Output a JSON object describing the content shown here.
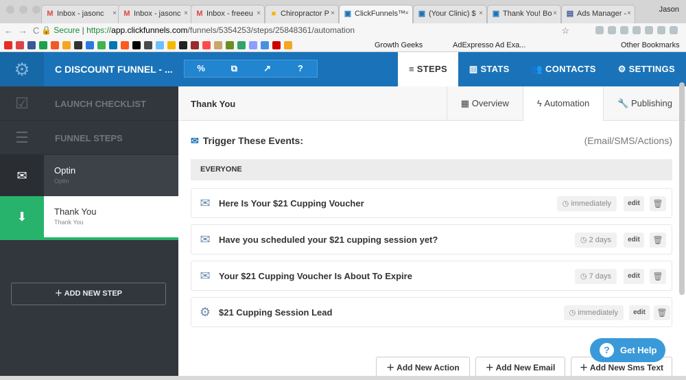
{
  "browser": {
    "tabs": [
      {
        "label": "Inbox - jasonc",
        "icon": "gmail-icon",
        "active": false
      },
      {
        "label": "Inbox - jasonc",
        "icon": "gmail-icon",
        "active": false
      },
      {
        "label": "Inbox - freeeu",
        "icon": "gmail-icon",
        "active": false
      },
      {
        "label": "Chiropractor P",
        "icon": "slides-icon",
        "active": false
      },
      {
        "label": "ClickFunnels™",
        "icon": "clickfunnels-icon",
        "active": true
      },
      {
        "label": "(Your Clinic) $",
        "icon": "clickfunnels-icon",
        "active": false
      },
      {
        "label": "Thank You! Bo",
        "icon": "clickfunnels-icon",
        "active": false
      },
      {
        "label": "Ads Manager -",
        "icon": "facebook-icon",
        "active": false
      }
    ],
    "profile": "Jason",
    "secure_label": "Secure",
    "url_scheme": "https://",
    "url_host": "app.clickfunnels.com",
    "url_path": "/funnels/5354253/steps/25848361/automation",
    "bookmarks": [
      "Growth Geeks",
      "AdExpresso Ad Exa..."
    ],
    "other_bookmarks": "Other Bookmarks"
  },
  "app": {
    "funnel_name": "C DISCOUNT FUNNEL - ...",
    "nav": [
      "STEPS",
      "STATS",
      "CONTACTS",
      "SETTINGS"
    ],
    "nav_icons": [
      "≡",
      "▥",
      "👥",
      "⚙"
    ],
    "sidebar": {
      "launch_checklist": "LAUNCH CHECKLIST",
      "funnel_steps": "FUNNEL STEPS",
      "steps": [
        {
          "name": "Optin",
          "sub": "Optin"
        },
        {
          "name": "Thank You",
          "sub": "Thank You"
        }
      ],
      "add_step": "ADD NEW STEP"
    },
    "page_title": "Thank You",
    "subtabs": [
      "Overview",
      "Automation",
      "Publishing"
    ],
    "trigger_title": "Trigger These Events:",
    "trigger_types": "(Email/SMS/Actions)",
    "group": "EVERYONE",
    "events": [
      {
        "name": "Here Is Your $21 Cupping Voucher",
        "timing": "immediately",
        "icon": "envelope-icon"
      },
      {
        "name": "Have you scheduled your $21 cupping session yet?",
        "timing": "2 days",
        "icon": "envelope-icon"
      },
      {
        "name": "Your $21 Cupping Voucher Is About To Expire",
        "timing": "7 days",
        "icon": "envelope-icon"
      },
      {
        "name": "$21 Cupping Session Lead",
        "timing": "immediately",
        "icon": "gear-icon"
      }
    ],
    "edit_label": "edit",
    "buttons": [
      "Add New Action",
      "Add New Email",
      "Add New Sms Text"
    ],
    "help": "Get Help",
    "colors": {
      "brand": "#1a73b8",
      "sidebar": "#32373d",
      "active_step": "#27b36b"
    }
  }
}
